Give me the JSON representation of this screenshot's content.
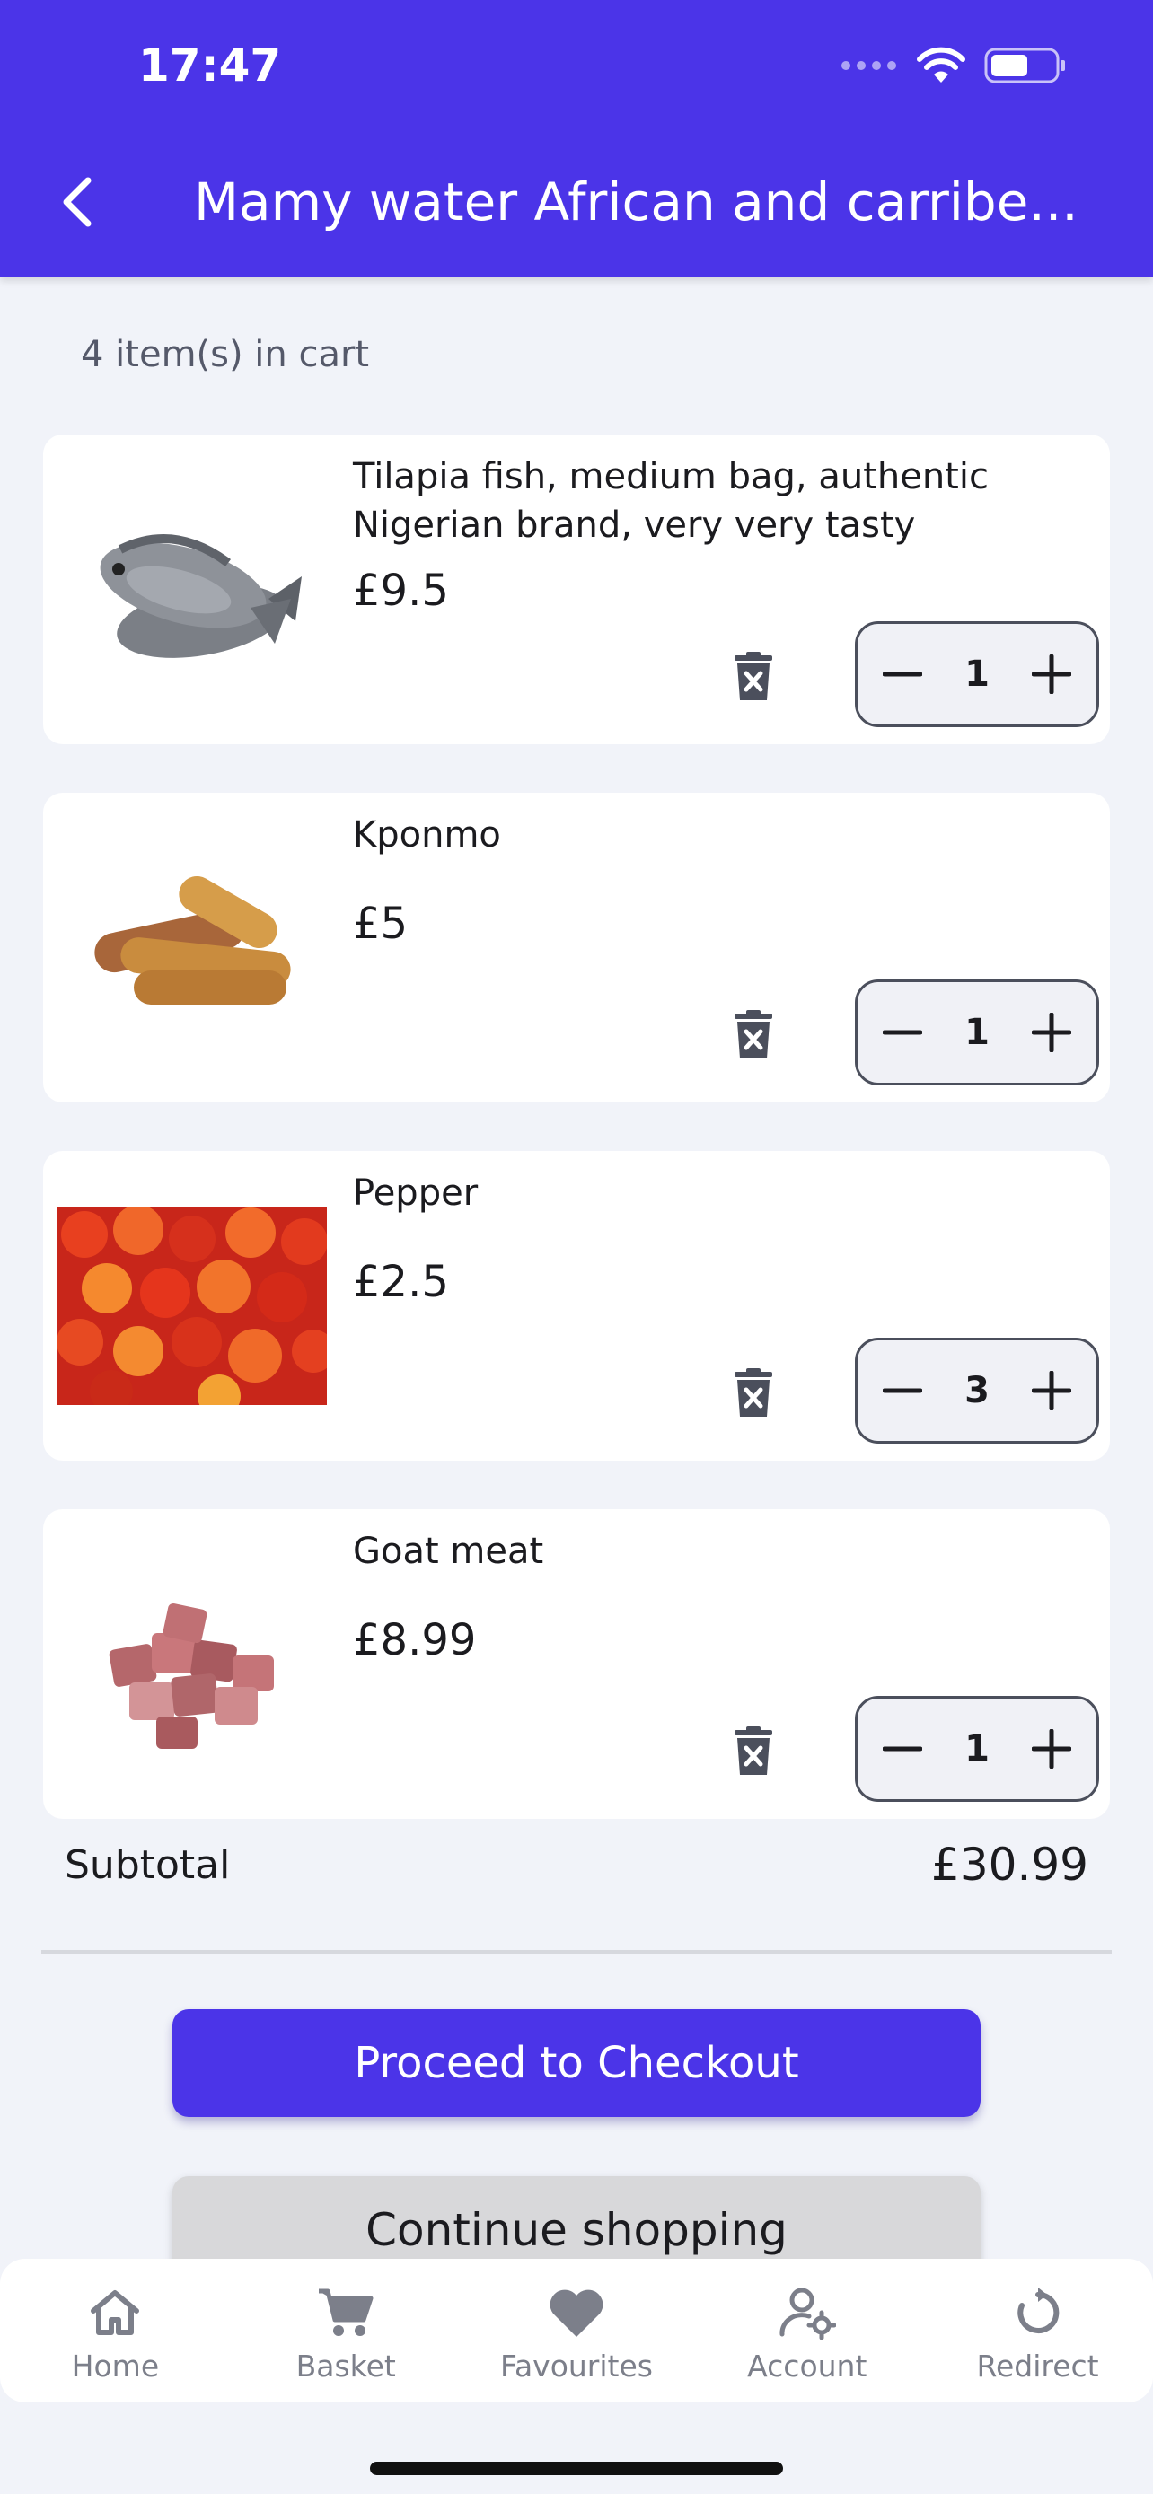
{
  "status_bar": {
    "time": "17:47"
  },
  "header": {
    "title": "Mamy water African and carribe..."
  },
  "cart": {
    "count_text": "4 item(s) in cart",
    "items": [
      {
        "name": "Tilapia fish, medium bag, authentic Nigerian brand, very very tasty",
        "price": "£9.5",
        "quantity": "1",
        "image": "tilapia-fish-image"
      },
      {
        "name": "Kponmo",
        "price": "£5",
        "quantity": "1",
        "image": "kponmo-image"
      },
      {
        "name": "Pepper",
        "price": "£2.5",
        "quantity": "3",
        "image": "pepper-image"
      },
      {
        "name": "Goat meat",
        "price": "£8.99",
        "quantity": "1",
        "image": "goat-meat-image"
      }
    ]
  },
  "summary": {
    "subtotal_label": "Subtotal",
    "subtotal_value": "£30.99"
  },
  "actions": {
    "checkout_label": "Proceed to Checkout",
    "continue_label": "Continue shopping"
  },
  "tabbar": {
    "items": [
      {
        "label": "Home",
        "icon": "home-icon"
      },
      {
        "label": "Basket",
        "icon": "basket-icon"
      },
      {
        "label": "Favourites",
        "icon": "heart-icon"
      },
      {
        "label": "Account",
        "icon": "account-settings-icon"
      },
      {
        "label": "Redirect",
        "icon": "redirect-icon"
      }
    ]
  },
  "colors": {
    "accent": "#4b34e8",
    "background": "#f1f3f9",
    "tab_inactive": "#7c7f8a"
  }
}
